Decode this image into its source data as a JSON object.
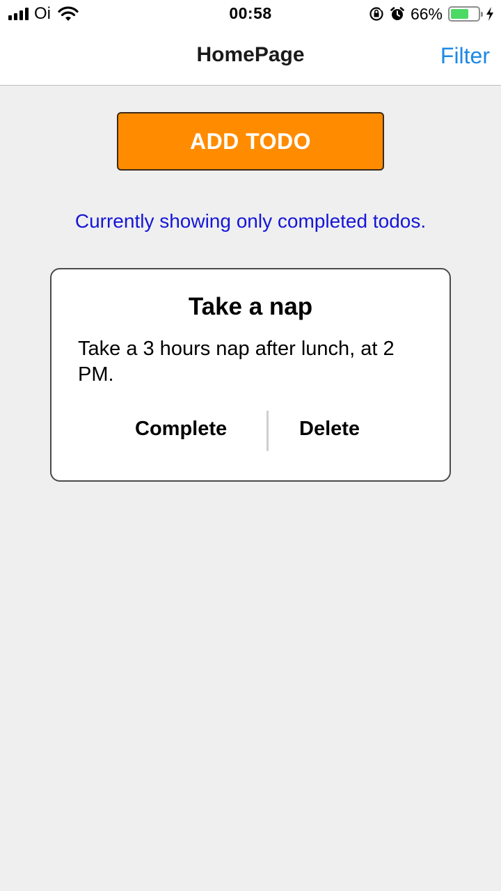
{
  "status_bar": {
    "carrier": "Oi",
    "time": "00:58",
    "battery_percent": "66%",
    "battery_level": 0.66,
    "icons": [
      "signal-icon",
      "wifi-icon",
      "orientation-lock-icon",
      "alarm-icon",
      "battery-icon",
      "charging-icon"
    ]
  },
  "nav": {
    "title": "HomePage",
    "filter_label": "Filter"
  },
  "add_button": {
    "label": "ADD TODO",
    "color": "#ff8c00"
  },
  "filter_note": "Currently showing only completed todos.",
  "todos": [
    {
      "title": "Take a nap",
      "description": "Take a 3 hours nap after lunch, at 2 PM.",
      "complete_label": "Complete",
      "delete_label": "Delete"
    }
  ],
  "colors": {
    "accent": "#1e88e5",
    "note": "#1515d8",
    "battery": "#4cd964"
  }
}
